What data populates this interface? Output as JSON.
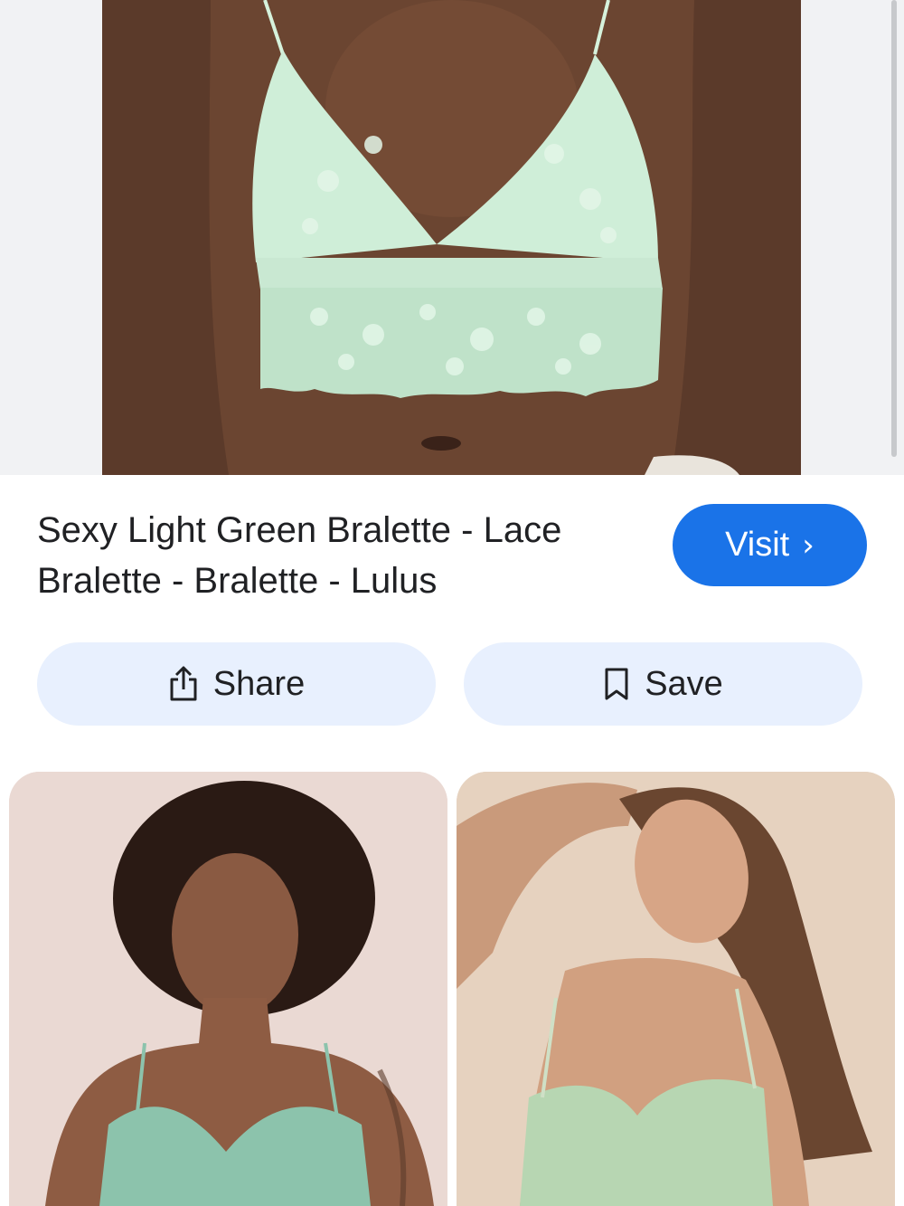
{
  "result": {
    "title": "Sexy Light Green Bralette - Lace Bralette - Bralette - Lulus",
    "visit_label": "Visit",
    "visit_chevron": "›"
  },
  "actions": {
    "share_label": "Share",
    "save_label": "Save"
  },
  "icons": {
    "share": "share-icon",
    "save": "bookmark-icon",
    "visit": "chevron-right-icon"
  },
  "colors": {
    "visit_button": "#1a73e8",
    "action_button": "#e8f0fe",
    "bralette_green": "#cfeed8"
  }
}
